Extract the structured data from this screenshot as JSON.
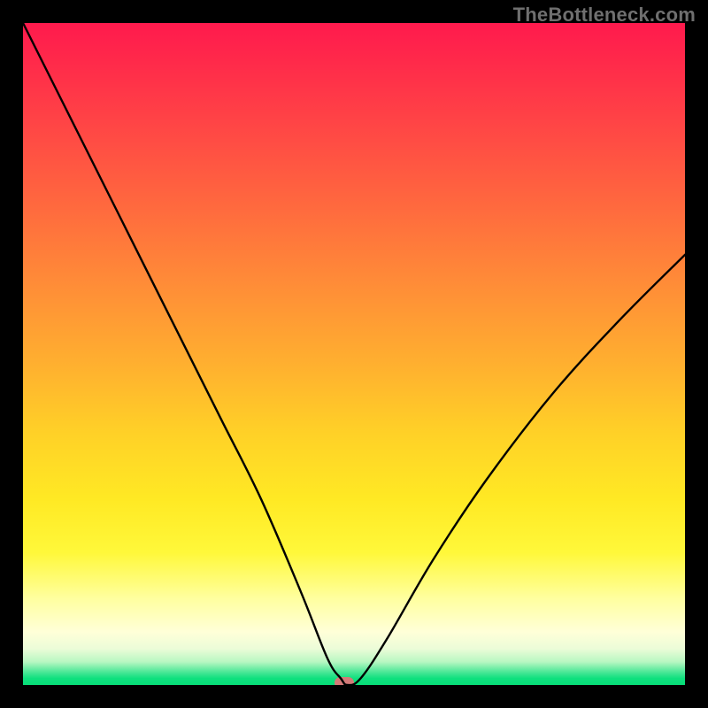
{
  "watermark": "TheBottleneck.com",
  "chart_data": {
    "type": "line",
    "title": "",
    "xlabel": "",
    "ylabel": "",
    "xlim": [
      0,
      100
    ],
    "ylim": [
      0,
      100
    ],
    "grid": false,
    "legend": false,
    "background_gradient": {
      "direction": "vertical",
      "stops": [
        {
          "pos": 0,
          "color": "#ff1a4d"
        },
        {
          "pos": 50,
          "color": "#ffb12f"
        },
        {
          "pos": 80,
          "color": "#fff83a"
        },
        {
          "pos": 95,
          "color": "#ecfcd8"
        },
        {
          "pos": 100,
          "color": "#08de78"
        }
      ]
    },
    "series": [
      {
        "name": "bottleneck-curve",
        "x": [
          0,
          6,
          12,
          18,
          24,
          30,
          36,
          42,
          46,
          48,
          49,
          51,
          55,
          62,
          70,
          80,
          90,
          100
        ],
        "y": [
          100,
          88,
          76,
          64,
          52,
          40,
          28,
          14,
          4,
          1,
          0,
          1,
          7,
          19,
          31,
          44,
          55,
          65
        ]
      }
    ],
    "marker": {
      "name": "optimal-point",
      "x": 48.5,
      "y": 0,
      "color": "#d47a78"
    }
  }
}
